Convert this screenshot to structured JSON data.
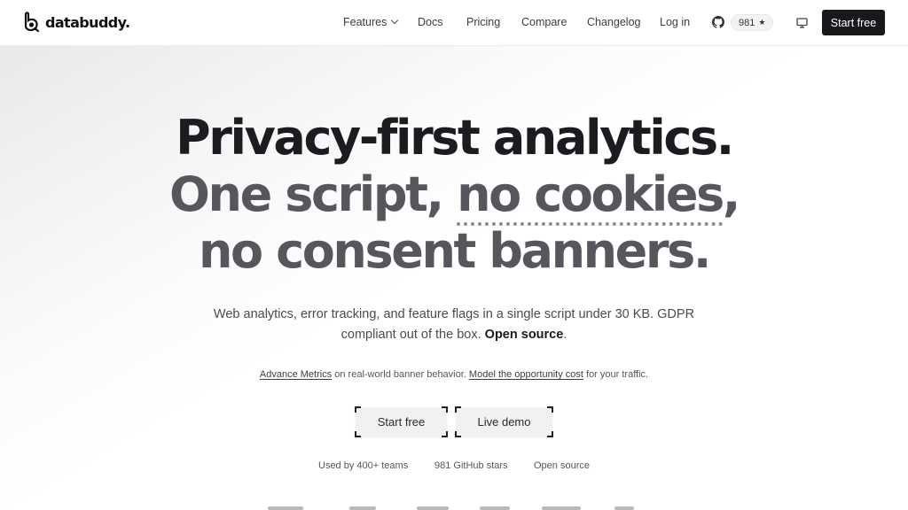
{
  "brand": {
    "name": "databuddy."
  },
  "nav": {
    "links": [
      {
        "label": "Features"
      },
      {
        "label": "Docs"
      },
      {
        "label": "Pricing"
      },
      {
        "label": "Compare"
      },
      {
        "label": "Changelog"
      },
      {
        "label": "Log in"
      }
    ],
    "github_stars": "981",
    "star_glyph": "★",
    "cta_label": "Start free"
  },
  "hero": {
    "line1": "Privacy-first analytics.",
    "line2_a": "One script, ",
    "line2_b": "no cookies",
    "line2_c": ",",
    "line3": "no consent banners.",
    "subtitle": "Web analytics, error tracking, and feature flags in a single script under 30 KB. GDPR compliant out of the box.",
    "subtitle_strong": "Open source",
    "subtitle_end": ".",
    "note": {
      "link1": "Advance Metrics",
      "text1": " on real-world banner behavior. ",
      "link2": "Model the opportunity cost",
      "text2": " for your traffic."
    },
    "cta_primary": "Start free",
    "cta_secondary": "Live demo",
    "stats": [
      "Used by 400+ teams",
      "981 GitHub stars",
      "Open source"
    ]
  },
  "colors": {
    "primary_button": "#19191d",
    "heading_dark": "#1c1c20",
    "heading_muted": "#56565d"
  },
  "icons": [
    "databuddy-logo-icon",
    "chevron-down-icon",
    "github-icon",
    "star-icon",
    "monitor-icon"
  ]
}
